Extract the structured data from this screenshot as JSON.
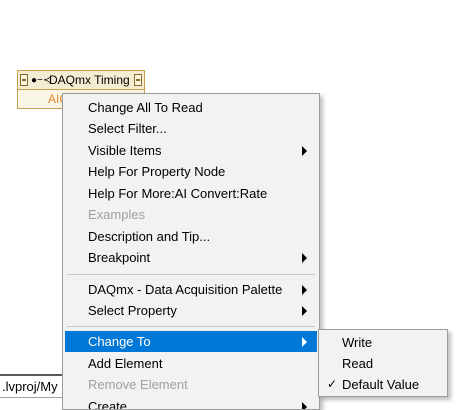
{
  "node": {
    "title": "DAQmx Timing",
    "icon": "property-node-icon",
    "row_label": "AIC"
  },
  "path_field": {
    "text": ".lvproj/My"
  },
  "context_menu": {
    "items": [
      {
        "label": "Change All To Read",
        "enabled": true,
        "submenu": false
      },
      {
        "label": "Select Filter...",
        "enabled": true,
        "submenu": false
      },
      {
        "label": "Visible Items",
        "enabled": true,
        "submenu": true
      },
      {
        "label": "Help For Property Node",
        "enabled": true,
        "submenu": false
      },
      {
        "label": "Help For More:AI Convert:Rate",
        "enabled": true,
        "submenu": false
      },
      {
        "label": "Examples",
        "enabled": false,
        "submenu": false
      },
      {
        "label": "Description and Tip...",
        "enabled": true,
        "submenu": false
      },
      {
        "label": "Breakpoint",
        "enabled": true,
        "submenu": true
      },
      {
        "label": "DAQmx - Data Acquisition Palette",
        "enabled": true,
        "submenu": true
      },
      {
        "label": "Select Property",
        "enabled": true,
        "submenu": true
      },
      {
        "label": "Change To",
        "enabled": true,
        "submenu": true,
        "highlighted": true
      },
      {
        "label": "Add Element",
        "enabled": true,
        "submenu": false
      },
      {
        "label": "Remove Element",
        "enabled": false,
        "submenu": false
      },
      {
        "label": "Create",
        "enabled": true,
        "submenu": true
      }
    ]
  },
  "change_to_submenu": {
    "items": [
      {
        "label": "Write",
        "checked": false
      },
      {
        "label": "Read",
        "checked": false
      },
      {
        "label": "Default Value",
        "checked": true
      }
    ],
    "check_glyph": "✓"
  },
  "colors": {
    "highlight": "#0078d7",
    "menu_bg": "#f2f2f2",
    "disabled_text": "#a0a0a0",
    "node_label": "#e8862c"
  }
}
